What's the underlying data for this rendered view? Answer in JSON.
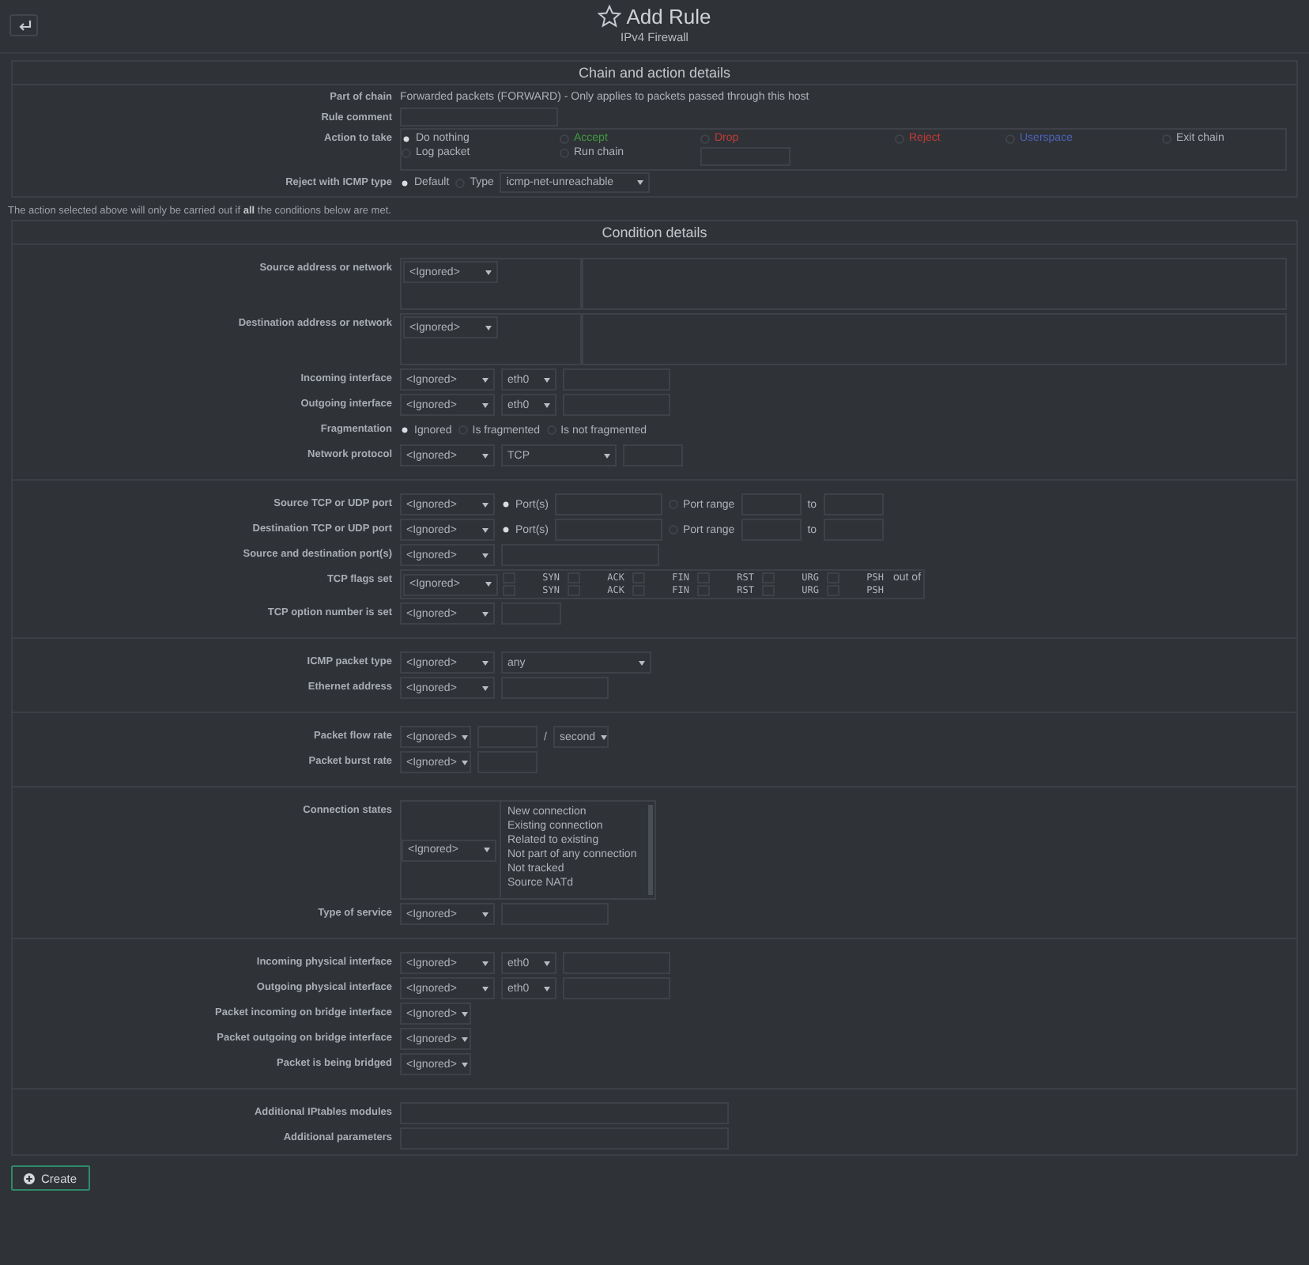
{
  "header": {
    "title": "Add Rule",
    "subtitle": "IPv4 Firewall"
  },
  "blocks": [
    {
      "kind": "section",
      "title": "Chain and action details",
      "groups": [
        [
          {
            "label": "Part of chain",
            "controls": [
              {
                "kind": "text",
                "text": "Forwarded packets (FORWARD) - Only applies to packets passed through this host"
              }
            ]
          },
          {
            "label": "Rule comment",
            "controls": [
              {
                "kind": "input-wide"
              }
            ]
          },
          {
            "label": "Action to take",
            "controls": [
              {
                "kind": "action-grid",
                "items": [
                  {
                    "kind": "radio",
                    "label": "Do nothing",
                    "selected": true
                  },
                  {
                    "kind": "radio",
                    "label": "Accept",
                    "selected": false,
                    "color": "#3f9b3f"
                  },
                  {
                    "kind": "radio",
                    "label": "Drop",
                    "selected": false,
                    "color": "#c33b36"
                  },
                  {
                    "kind": "radio",
                    "label": "Reject",
                    "selected": false,
                    "color": "#c33b36"
                  },
                  {
                    "kind": "radio",
                    "label": "Userspace",
                    "selected": false,
                    "color": "#4a64b8"
                  },
                  {
                    "kind": "radio",
                    "label": "Exit chain",
                    "selected": false
                  },
                  {
                    "kind": "radio",
                    "label": "Log packet",
                    "selected": false
                  },
                  {
                    "kind": "radio",
                    "label": "Run chain",
                    "selected": false
                  },
                  {
                    "kind": "input"
                  }
                ]
              }
            ]
          },
          {
            "label": "Reject with ICMP type",
            "controls": [
              {
                "kind": "radio",
                "label": "Default",
                "selected": true
              },
              {
                "kind": "radio",
                "label": "Type",
                "selected": false
              },
              {
                "kind": "select-wide",
                "value": "icmp-net-unreachable"
              }
            ]
          }
        ]
      ]
    },
    {
      "kind": "note",
      "text": "The action selected above will only be carried out if **all** the conditions below are met."
    },
    {
      "kind": "section",
      "title": "Condition details",
      "groups": [
        [
          {
            "label": "Source address or network",
            "controls": [
              {
                "kind": "select-boxed",
                "value": "<Ignored>"
              },
              {
                "kind": "textarea"
              }
            ]
          },
          {
            "label": "Destination address or network",
            "controls": [
              {
                "kind": "select-boxed",
                "value": "<Ignored>"
              },
              {
                "kind": "textarea"
              }
            ]
          },
          {
            "label": "Incoming interface",
            "controls": [
              {
                "kind": "select",
                "value": "<Ignored>"
              },
              {
                "kind": "select-tiny",
                "value": "eth0"
              },
              {
                "kind": "input-medium"
              }
            ]
          },
          {
            "label": "Outgoing interface",
            "controls": [
              {
                "kind": "select",
                "value": "<Ignored>"
              },
              {
                "kind": "select-tiny",
                "value": "eth0"
              },
              {
                "kind": "input-medium"
              }
            ]
          },
          {
            "label": "Fragmentation",
            "controls": [
              {
                "kind": "radio",
                "label": "Ignored",
                "selected": true
              },
              {
                "kind": "radio",
                "label": "Is fragmented",
                "selected": false
              },
              {
                "kind": "radio",
                "label": "Is not fragmented",
                "selected": false
              }
            ]
          },
          {
            "label": "Network protocol",
            "controls": [
              {
                "kind": "select",
                "value": "<Ignored>"
              },
              {
                "kind": "select-mid",
                "value": "TCP"
              },
              {
                "kind": "input-short"
              }
            ]
          }
        ],
        [
          {
            "label": "Source TCP or UDP port",
            "controls": [
              {
                "kind": "select",
                "value": "<Ignored>"
              },
              {
                "kind": "radio",
                "label": "Port(s)",
                "selected": true
              },
              {
                "kind": "input-medium"
              },
              {
                "kind": "radio",
                "label": "Port range",
                "selected": false
              },
              {
                "kind": "input-short"
              },
              {
                "kind": "text",
                "text": "to"
              },
              {
                "kind": "input-short"
              }
            ]
          },
          {
            "label": "Destination TCP or UDP port",
            "controls": [
              {
                "kind": "select",
                "value": "<Ignored>"
              },
              {
                "kind": "radio",
                "label": "Port(s)",
                "selected": true
              },
              {
                "kind": "input-medium"
              },
              {
                "kind": "radio",
                "label": "Port range",
                "selected": false
              },
              {
                "kind": "input-short"
              },
              {
                "kind": "text",
                "text": "to"
              },
              {
                "kind": "input-short"
              }
            ]
          },
          {
            "label": "Source and destination port(s)",
            "controls": [
              {
                "kind": "select",
                "value": "<Ignored>"
              },
              {
                "kind": "input-wide"
              }
            ]
          },
          {
            "label": "TCP flags set",
            "controls": [
              {
                "kind": "flags",
                "value": "<Ignored>",
                "rows": [
                  {
                    "flags": [
                      {
                        "label": "SYN",
                        "checked": false
                      },
                      {
                        "label": "ACK",
                        "checked": false
                      },
                      {
                        "label": "FIN",
                        "checked": false
                      },
                      {
                        "label": "RST",
                        "checked": false
                      },
                      {
                        "label": "URG",
                        "checked": false
                      },
                      {
                        "label": "PSH",
                        "checked": false
                      }
                    ],
                    "suffix": "out of"
                  },
                  {
                    "flags": [
                      {
                        "label": "SYN",
                        "checked": false
                      },
                      {
                        "label": "ACK",
                        "checked": false
                      },
                      {
                        "label": "FIN",
                        "checked": false
                      },
                      {
                        "label": "RST",
                        "checked": false
                      },
                      {
                        "label": "URG",
                        "checked": false
                      },
                      {
                        "label": "PSH",
                        "checked": false
                      }
                    ]
                  }
                ]
              }
            ]
          },
          {
            "label": "TCP option number is set",
            "controls": [
              {
                "kind": "select",
                "value": "<Ignored>"
              },
              {
                "kind": "input-short"
              }
            ]
          }
        ],
        [
          {
            "label": "ICMP packet type",
            "controls": [
              {
                "kind": "select",
                "value": "<Ignored>"
              },
              {
                "kind": "select-wide",
                "value": "any"
              }
            ]
          },
          {
            "label": "Ethernet address",
            "controls": [
              {
                "kind": "select",
                "value": "<Ignored>"
              },
              {
                "kind": "input-medium"
              }
            ]
          }
        ],
        [
          {
            "label": "Packet flow rate",
            "controls": [
              {
                "kind": "select-short",
                "value": "<Ignored>"
              },
              {
                "kind": "input-short"
              },
              {
                "kind": "text",
                "text": "/"
              },
              {
                "kind": "select-tiny",
                "value": "second"
              }
            ]
          },
          {
            "label": "Packet burst rate",
            "controls": [
              {
                "kind": "select-short",
                "value": "<Ignored>"
              },
              {
                "kind": "input-short"
              }
            ]
          }
        ],
        [
          {
            "label": "Connection states",
            "controls": [
              {
                "kind": "listbox",
                "value": "<Ignored>",
                "options": [
                  "New connection",
                  "Existing connection",
                  "Related to existing",
                  "Not part of any connection",
                  "Not tracked",
                  "Source NATd"
                ]
              }
            ]
          },
          {
            "label": "Type of service",
            "controls": [
              {
                "kind": "select",
                "value": "<Ignored>"
              },
              {
                "kind": "input-medium"
              }
            ]
          }
        ],
        [
          {
            "label": "Incoming physical interface",
            "controls": [
              {
                "kind": "select",
                "value": "<Ignored>"
              },
              {
                "kind": "select-tiny",
                "value": "eth0"
              },
              {
                "kind": "input-medium"
              }
            ]
          },
          {
            "label": "Outgoing physical interface",
            "controls": [
              {
                "kind": "select",
                "value": "<Ignored>"
              },
              {
                "kind": "select-tiny",
                "value": "eth0"
              },
              {
                "kind": "input-medium"
              }
            ]
          },
          {
            "label": "Packet incoming on bridge interface",
            "controls": [
              {
                "kind": "select-short",
                "value": "<Ignored>"
              }
            ]
          },
          {
            "label": "Packet outgoing on bridge interface",
            "controls": [
              {
                "kind": "select-short",
                "value": "<Ignored>"
              }
            ]
          },
          {
            "label": "Packet is being bridged",
            "controls": [
              {
                "kind": "select-short",
                "value": "<Ignored>"
              }
            ]
          }
        ],
        [
          {
            "label": "Additional IPtables modules",
            "controls": [
              {
                "kind": "input-full"
              }
            ]
          },
          {
            "label": "Additional parameters",
            "controls": [
              {
                "kind": "input-full"
              }
            ]
          }
        ]
      ]
    }
  ],
  "create_button": {
    "label": "Create"
  }
}
